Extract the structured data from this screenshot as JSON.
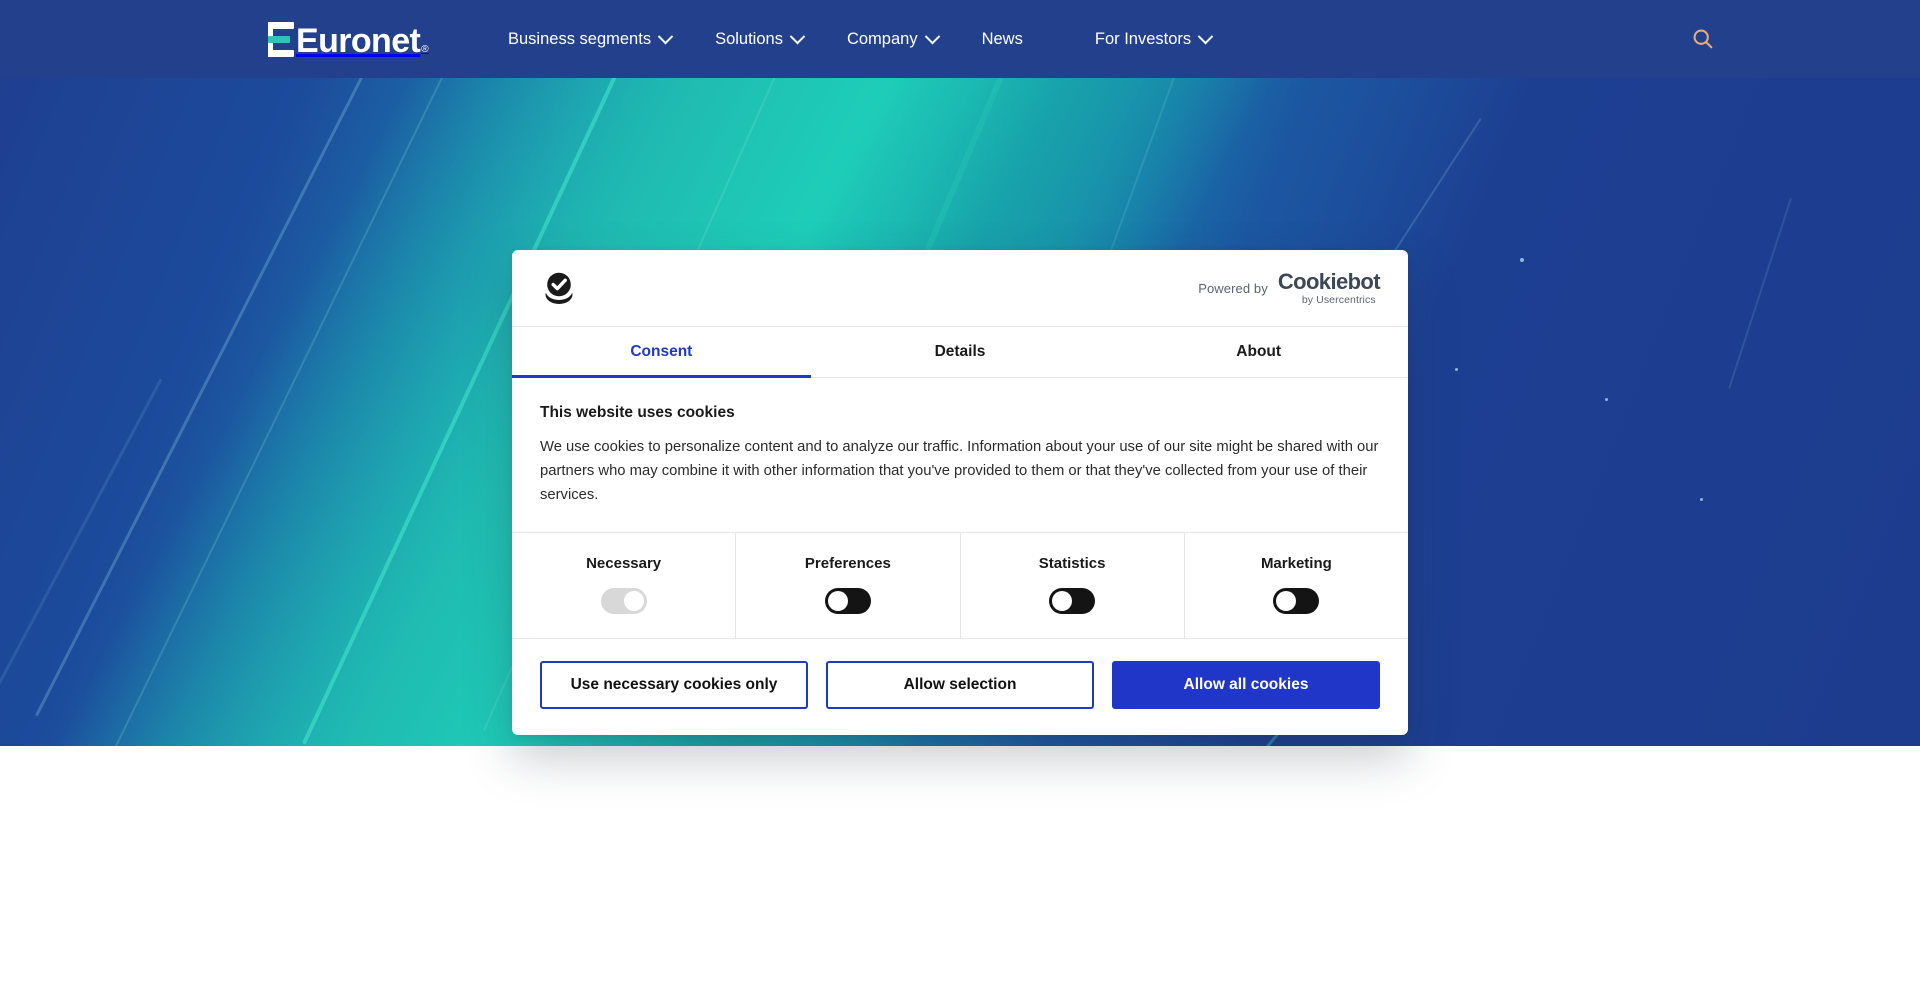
{
  "brand": {
    "name": "Euronet",
    "registered_mark": "®"
  },
  "nav": {
    "items": [
      {
        "label": "Business segments",
        "has_dropdown": true
      },
      {
        "label": "Solutions",
        "has_dropdown": true
      },
      {
        "label": "Company",
        "has_dropdown": true
      },
      {
        "label": "News",
        "has_dropdown": false
      },
      {
        "label": "For Investors",
        "has_dropdown": true
      }
    ],
    "search_icon": "search-icon",
    "bar_color": "#22408c",
    "search_icon_color": "#e8a87c"
  },
  "hero": {
    "image_description": "abstract blue to teal aerial ocean gradient",
    "colors": {
      "deep_blue": "#1d3c8e",
      "teal": "#17c3a6",
      "mid_blue": "#1a7fae"
    }
  },
  "cookie_dialog": {
    "logo_icon": "cookiebot-cookie-check-icon",
    "powered_by": {
      "label": "Powered by",
      "brand": "Cookiebot",
      "sub_brand": "by Usercentrics"
    },
    "tabs": [
      {
        "label": "Consent",
        "active": true
      },
      {
        "label": "Details",
        "active": false
      },
      {
        "label": "About",
        "active": false
      }
    ],
    "active_tab_color": "#1f39c4",
    "body": {
      "title": "This website uses cookies",
      "text": "We use cookies to personalize content and to analyze our traffic. Information about your use of our site might be shared with our partners who may combine it with other information that you've provided to them or that they've collected from your use of their services."
    },
    "categories": [
      {
        "label": "Necessary",
        "state": "on",
        "disabled": true
      },
      {
        "label": "Preferences",
        "state": "off",
        "disabled": false
      },
      {
        "label": "Statistics",
        "state": "off",
        "disabled": false
      },
      {
        "label": "Marketing",
        "state": "off",
        "disabled": false
      }
    ],
    "buttons": [
      {
        "label": "Use necessary cookies only",
        "style": "outline"
      },
      {
        "label": "Allow selection",
        "style": "outline"
      },
      {
        "label": "Allow all cookies",
        "style": "primary"
      }
    ]
  }
}
